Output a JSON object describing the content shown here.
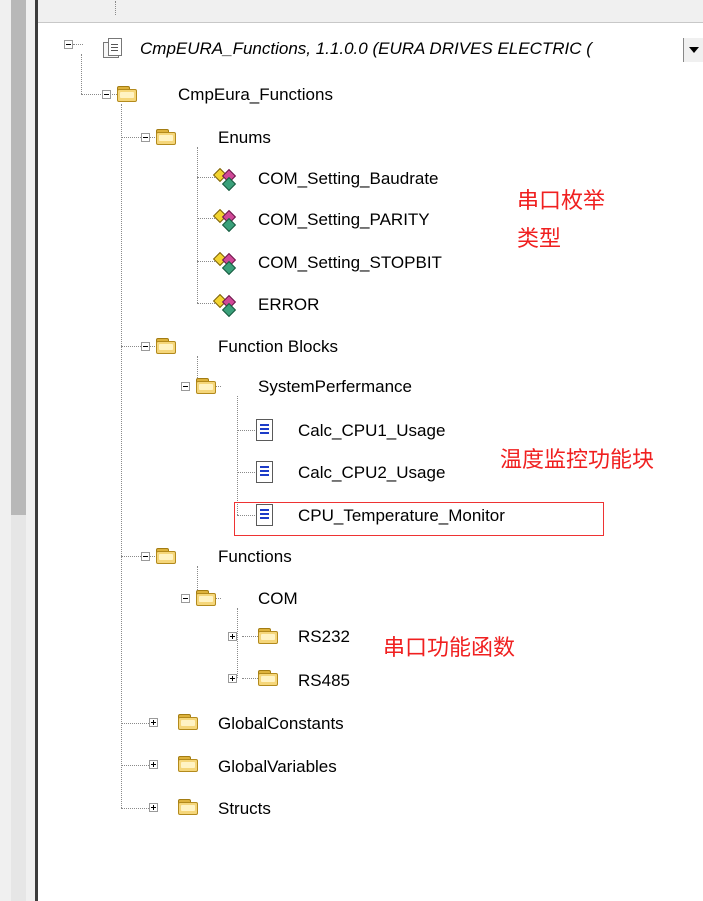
{
  "tree": {
    "root": {
      "label": "CmpEURA_Functions, 1.1.0.0 (EURA DRIVES ELECTRIC (",
      "expanded": true,
      "icon": "library-doc-icon"
    },
    "nodes": {
      "cmp_eura_functions": {
        "label": "CmpEura_Functions",
        "expanded": true,
        "icon": "folder-icon"
      },
      "enums": {
        "label": "Enums",
        "expanded": true,
        "icon": "folder-icon"
      },
      "com_setting_baudrate": {
        "label": "COM_Setting_Baudrate",
        "icon": "enum-icon"
      },
      "com_setting_parity": {
        "label": "COM_Setting_PARITY",
        "icon": "enum-icon"
      },
      "com_setting_stopbit": {
        "label": "COM_Setting_STOPBIT",
        "icon": "enum-icon"
      },
      "error": {
        "label": "ERROR",
        "icon": "enum-icon"
      },
      "function_blocks": {
        "label": "Function Blocks",
        "expanded": true,
        "icon": "folder-icon"
      },
      "system_perfermance": {
        "label": "SystemPerfermance",
        "expanded": true,
        "icon": "folder-icon"
      },
      "calc_cpu1_usage": {
        "label": "Calc_CPU1_Usage",
        "icon": "pou-icon"
      },
      "calc_cpu2_usage": {
        "label": "Calc_CPU2_Usage",
        "icon": "pou-icon"
      },
      "cpu_temperature_monitor": {
        "label": "CPU_Temperature_Monitor",
        "icon": "pou-icon"
      },
      "functions": {
        "label": "Functions",
        "expanded": true,
        "icon": "folder-icon"
      },
      "com": {
        "label": "COM",
        "expanded": true,
        "icon": "folder-icon"
      },
      "rs232": {
        "label": "RS232",
        "expanded": false,
        "icon": "folder-icon"
      },
      "rs485": {
        "label": "RS485",
        "expanded": false,
        "icon": "folder-icon"
      },
      "global_constants": {
        "label": "GlobalConstants",
        "expanded": false,
        "icon": "folder-icon"
      },
      "global_variables": {
        "label": "GlobalVariables",
        "expanded": false,
        "icon": "folder-icon"
      },
      "structs": {
        "label": "Structs",
        "expanded": false,
        "icon": "folder-icon"
      }
    }
  },
  "annotations": {
    "serial_enum_line1": "串口枚举",
    "serial_enum_line2": "类型",
    "temperature_fb": "温度监控功能块",
    "serial_functions": "串口功能函数"
  },
  "colors": {
    "annotation_red": "#f02020",
    "folder_yellow": "#f5d67a",
    "doc_blue": "#1d3cc8"
  }
}
